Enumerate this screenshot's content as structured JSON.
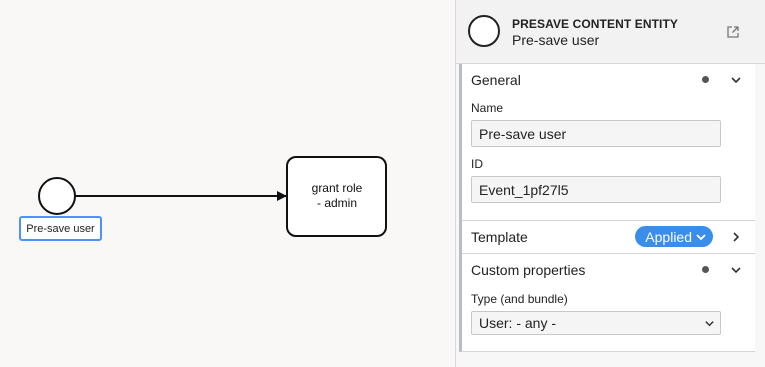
{
  "canvas": {
    "start_event_label": "Pre-save user",
    "task": {
      "line1": "grant role",
      "line2": "- admin"
    }
  },
  "panel": {
    "header": {
      "type": "PRESAVE CONTENT ENTITY",
      "name": "Pre-save user",
      "icon": "external-link-icon"
    },
    "general": {
      "title": "General",
      "name_label": "Name",
      "name_value": "Pre-save user",
      "id_label": "ID",
      "id_value": "Event_1pf27l5"
    },
    "template": {
      "title": "Template",
      "badge": "Applied"
    },
    "custom_properties": {
      "title": "Custom properties",
      "type_label": "Type (and bundle)",
      "type_value": "User: - any -"
    }
  },
  "colors": {
    "accent": "#3a8dea",
    "selection": "#4d90fe"
  }
}
